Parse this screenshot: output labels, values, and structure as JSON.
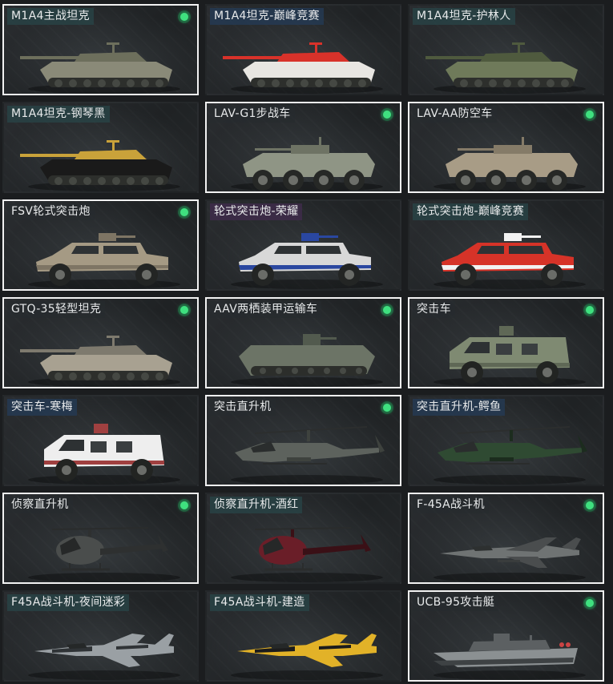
{
  "vehicles": [
    {
      "name": "M1A4主战坦克",
      "owned": true,
      "selected": true,
      "tint": "std",
      "shape": "tank",
      "body": "#8a8a78",
      "accent": "#6d6f5c"
    },
    {
      "name": "M1A4坦克-巅峰竞赛",
      "owned": false,
      "selected": false,
      "tint": "blue",
      "shape": "tank",
      "body": "#e8e6e2",
      "accent": "#d8322a"
    },
    {
      "name": "M1A4坦克-护林人",
      "owned": false,
      "selected": false,
      "tint": "std",
      "shape": "tank",
      "body": "#6f7a5a",
      "accent": "#4f5a3e"
    },
    {
      "name": "M1A4坦克-钢琴黑",
      "owned": false,
      "selected": false,
      "tint": "std",
      "shape": "tank",
      "body": "#1a1a1a",
      "accent": "#c9a23a"
    },
    {
      "name": "LAV-G1步战车",
      "owned": true,
      "selected": true,
      "tint": "none",
      "shape": "apc8",
      "body": "#8f9585",
      "accent": "#6e7364"
    },
    {
      "name": "LAV-AA防空车",
      "owned": true,
      "selected": true,
      "tint": "none",
      "shape": "apc8",
      "body": "#a89c86",
      "accent": "#857b68"
    },
    {
      "name": "FSV轮式突击炮",
      "owned": true,
      "selected": true,
      "tint": "none",
      "shape": "jeep",
      "body": "#a59a84",
      "accent": "#7e7564"
    },
    {
      "name": "轮式突击炮-荣耀",
      "owned": false,
      "selected": false,
      "tint": "pur",
      "shape": "jeep",
      "body": "#d8d8d8",
      "accent": "#2a47a0"
    },
    {
      "name": "轮式突击炮-巅峰竞赛",
      "owned": false,
      "selected": false,
      "tint": "std",
      "shape": "jeep",
      "body": "#d63328",
      "accent": "#f2f2f2"
    },
    {
      "name": "GTQ-35轻型坦克",
      "owned": true,
      "selected": true,
      "tint": "none",
      "shape": "tank",
      "body": "#a8a191",
      "accent": "#7e7a6e"
    },
    {
      "name": "AAV两栖装甲运输车",
      "owned": true,
      "selected": true,
      "tint": "none",
      "shape": "amphib",
      "body": "#6c7466",
      "accent": "#525a4e"
    },
    {
      "name": "突击车",
      "owned": true,
      "selected": true,
      "tint": "none",
      "shape": "mrap",
      "body": "#7f8a72",
      "accent": "#5f6856"
    },
    {
      "name": "突击车-寒梅",
      "owned": false,
      "selected": false,
      "tint": "blue",
      "shape": "mrap",
      "body": "#eeeeee",
      "accent": "#a04040"
    },
    {
      "name": "突击直升机",
      "owned": true,
      "selected": true,
      "tint": "none",
      "shape": "heli",
      "body": "#5d625d",
      "accent": "#3e423e"
    },
    {
      "name": "突击直升机-鳄鱼",
      "owned": false,
      "selected": false,
      "tint": "blue",
      "shape": "heli",
      "body": "#2f4a32",
      "accent": "#1c2c1e"
    },
    {
      "name": "侦察直升机",
      "owned": true,
      "selected": true,
      "tint": "none",
      "shape": "scout",
      "body": "#4a4d4c",
      "accent": "#2e3030"
    },
    {
      "name": "侦察直升机-酒红",
      "owned": false,
      "selected": false,
      "tint": "std",
      "shape": "scout",
      "body": "#6a1e28",
      "accent": "#3a1016"
    },
    {
      "name": "F-45A战斗机",
      "owned": true,
      "selected": true,
      "tint": "none",
      "shape": "jet",
      "body": "#6f7373",
      "accent": "#4a4d4e"
    },
    {
      "name": "F45A战斗机-夜间迷彩",
      "owned": false,
      "selected": false,
      "tint": "std",
      "shape": "jet2",
      "body": "#9aa0a4",
      "accent": "#2f3336"
    },
    {
      "name": "F45A战斗机-建造",
      "owned": false,
      "selected": false,
      "tint": "std",
      "shape": "jet2",
      "body": "#e2b228",
      "accent": "#1c1c1c"
    },
    {
      "name": "UCB-95攻击艇",
      "owned": true,
      "selected": true,
      "tint": "none",
      "shape": "boat",
      "body": "#8b9092",
      "accent": "#5c6062"
    }
  ]
}
